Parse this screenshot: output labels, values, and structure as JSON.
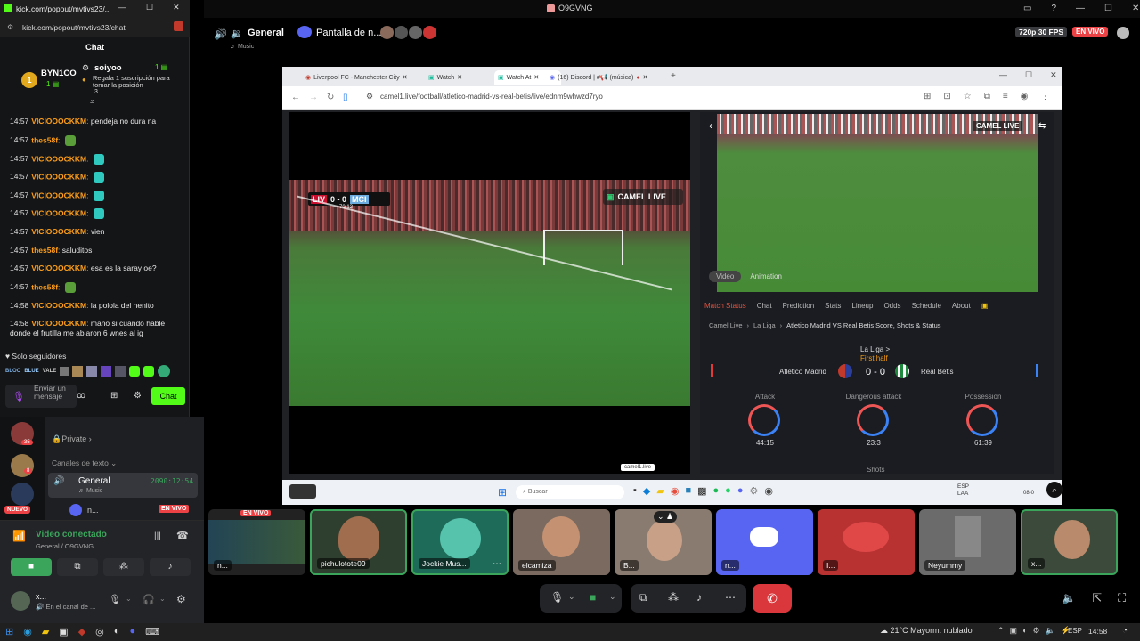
{
  "window_title": "O9GVNG",
  "chat_popout": {
    "window_title": "kick.com/popout/mvtivs23/...",
    "url": "kick.com/popout/mvtivs23/chat",
    "header": "Chat",
    "pinned": {
      "badge_user": "BYN1CO",
      "badge_count": "1",
      "user": "soiyoo",
      "count": "1",
      "text": "Regala 1 suscripción para tomar la posición",
      "rank": "3"
    },
    "messages": [
      {
        "time": "14:57",
        "user": "VICIOOOCKKM",
        "color": "#ff9f1a",
        "text": "pendeja no dura na"
      },
      {
        "time": "14:57",
        "user": "thes58f",
        "color": "#ff9f1a",
        "text": "",
        "emote": "#5a9e3a"
      },
      {
        "time": "14:57",
        "user": "VICIOOOCKKM",
        "color": "#ff9f1a",
        "text": "",
        "emote": "#2fc9c0"
      },
      {
        "time": "14:57",
        "user": "VICIOOOCKKM",
        "color": "#ff9f1a",
        "text": "",
        "emote": "#2fc9c0"
      },
      {
        "time": "14:57",
        "user": "VICIOOOCKKM",
        "color": "#ff9f1a",
        "text": "",
        "emote": "#2fc9c0"
      },
      {
        "time": "14:57",
        "user": "VICIOOOCKKM",
        "color": "#ff9f1a",
        "text": "",
        "emote": "#2fc9c0"
      },
      {
        "time": "14:57",
        "user": "VICIOOOCKKM",
        "color": "#ff9f1a",
        "text": "vien"
      },
      {
        "time": "14:57",
        "user": "thes58f",
        "color": "#ff9f1a",
        "text": "saluditos"
      },
      {
        "time": "14:57",
        "user": "VICIOOOCKKM",
        "color": "#ff9f1a",
        "text": "esa es la saray oe?"
      },
      {
        "time": "14:57",
        "user": "thes58f",
        "color": "#ff9f1a",
        "text": "",
        "emote": "#5a9e3a"
      },
      {
        "time": "14:58",
        "user": "VICIOOOCKKM",
        "color": "#ff9f1a",
        "text": "la polola del nenito"
      },
      {
        "time": "14:58",
        "user": "VICIOOOCKKM",
        "color": "#ff9f1a",
        "text": "mano si cuando hable donde el frutilla me ablaron 6 wnes al ig"
      }
    ],
    "followers_only": "Solo seguidores",
    "input_placeholder": "Enviar un mensaje",
    "chat_button": "Chat"
  },
  "topbar": {
    "channel": "General",
    "screen_share": "Pantalla de n...",
    "music": "Music",
    "quality": "720p 30 FPS",
    "live": "EN VIVO"
  },
  "sidebar": {
    "private": "Private",
    "channels_header": "Canales de texto",
    "voice_channel": "General",
    "voice_timer": "2090:12:54",
    "voice_sub": "Music",
    "member": "n...",
    "member_live": "EN VIVO",
    "new_badge": "NUEVO",
    "badge_a": "35",
    "badge_b": "8",
    "connection_status": "Video conectado",
    "connection_sub": "General / O9GVNG",
    "user_name": "x...",
    "user_status": "En el canal de ..."
  },
  "browser": {
    "tabs": [
      "Liverpool FC - Manchester City",
      "Watch",
      "Watch At",
      "(16) Discord | #📢 (música)"
    ],
    "url": "camel1.live/football/atletico-madrid-vs-real-betis/live/ednm9whwzd7ryo",
    "video_score_home": "LIV",
    "video_score": "0 - 0",
    "video_score_away": "MCI",
    "video_clock": "70:12",
    "camel_logo": "CAMEL LIVE",
    "side_tabs": [
      "Video",
      "Animation"
    ],
    "match_tabs": [
      "Match Status",
      "Chat",
      "Prediction",
      "Stats",
      "Lineup",
      "Odds",
      "Schedule",
      "About"
    ],
    "breadcrumb": [
      "Camel Live",
      "La Liga",
      "Atletico Madrid VS Real Betis Score, Shots & Status"
    ],
    "league": "La Liga >",
    "period": "First half",
    "home_team": "Atletico Madrid",
    "score": "0 - 0",
    "away_team": "Real Betis",
    "stats": [
      {
        "label": "Attack",
        "value": "44:15"
      },
      {
        "label": "Dangerous attack",
        "value": "23:3"
      },
      {
        "label": "Possession",
        "value": "61:39"
      }
    ],
    "shots_label": "Shots",
    "small_url": "camel1.live",
    "search": "Buscar",
    "inner_lang": "ESP",
    "inner_lang2": "LAA",
    "inner_date": "08-0"
  },
  "participants": [
    {
      "name": "n...",
      "live": "EN VIVO"
    },
    {
      "name": "pichulotote09"
    },
    {
      "name": "Jockie Mus..."
    },
    {
      "name": "elcamiza"
    },
    {
      "name": "B..."
    },
    {
      "name": "n..."
    },
    {
      "name": "I..."
    },
    {
      "name": "Neyummy"
    },
    {
      "name": "x..."
    }
  ],
  "taskbar": {
    "weather": "21°C  Mayorm. nublado",
    "lang": "ESP",
    "time": "14:58"
  }
}
